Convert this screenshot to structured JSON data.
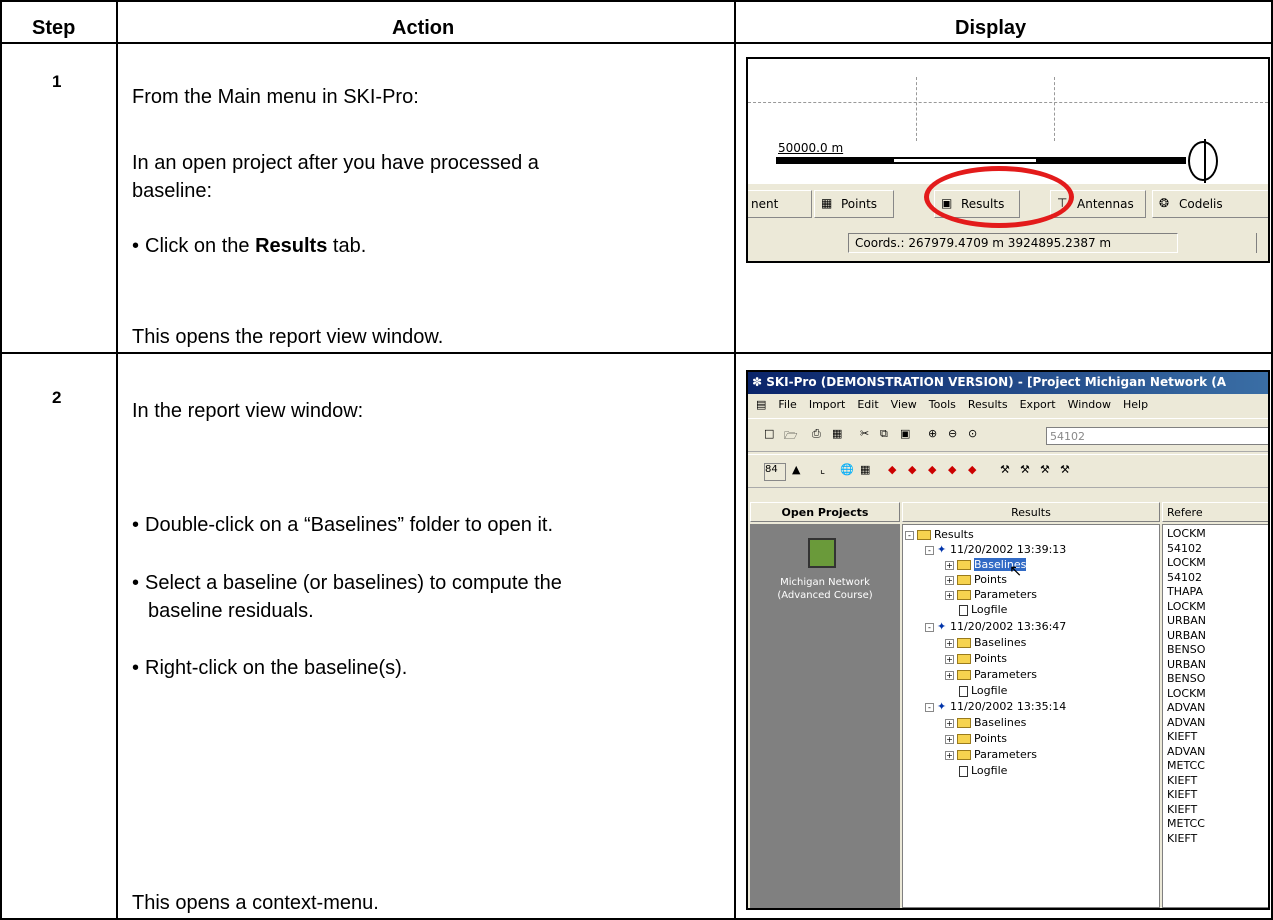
{
  "table": {
    "headers": {
      "step": "Step",
      "action": "Action",
      "display": "Display"
    },
    "rows": [
      {
        "step": "1",
        "lines": [
          "From the Main menu in SKI-Pro:",
          "In an open project after you have processed a",
          "baseline:",
          "Click on the ",
          "Results",
          " tab.",
          "This opens the report view window."
        ]
      },
      {
        "step": "2",
        "lines": [
          "In the report view window:",
          "Double-click on a “Baselines” folder to open it.",
          "Select a baseline (or baselines) to compute the",
          "baseline residuals.",
          "Right-click on the baseline(s).",
          "This opens a context-menu."
        ]
      }
    ]
  },
  "shot1": {
    "scale_label": "50000.0 m",
    "tabs": [
      "nent",
      "Points",
      "Results",
      "Antennas",
      "Codelis"
    ],
    "coords": "Coords.: 267979.4709 m  3924895.2387 m",
    "highlight_color": "#e31b1b"
  },
  "shot2": {
    "title": "SKI-Pro (DEMONSTRATION VERSION) - [Project Michigan Network (A",
    "menu": [
      "File",
      "Import",
      "Edit",
      "View",
      "Tools",
      "Results",
      "Export",
      "Window",
      "Help"
    ],
    "toolbar_input": "54102",
    "toolbar2_num": "84",
    "panels": {
      "left": "Open Projects",
      "mid": "Results",
      "right": "Refere"
    },
    "project_label": "Michigan Network (Advanced Course)",
    "tree": [
      {
        "label": "Results"
      },
      {
        "label": "11/20/2002 13:39:13"
      },
      {
        "label": "Baselines"
      },
      {
        "label": "Points"
      },
      {
        "label": "Parameters"
      },
      {
        "label": "Logfile"
      },
      {
        "label": "11/20/2002 13:36:47"
      },
      {
        "label": "Baselines"
      },
      {
        "label": "Points"
      },
      {
        "label": "Parameters"
      },
      {
        "label": "Logfile"
      },
      {
        "label": "11/20/2002 13:35:14"
      },
      {
        "label": "Baselines"
      },
      {
        "label": "Points"
      },
      {
        "label": "Parameters"
      },
      {
        "label": "Logfile"
      }
    ],
    "refs": [
      "LOCKM",
      "54102",
      "LOCKM",
      "54102",
      "THAPA",
      "LOCKM",
      "URBAN",
      "URBAN",
      "BENSO",
      "URBAN",
      "BENSO",
      "LOCKM",
      "ADVAN",
      "ADVAN",
      "KIEFT",
      "ADVAN",
      "METCC",
      "KIEFT",
      "KIEFT",
      "KIEFT",
      "METCC",
      "KIEFT"
    ],
    "title_color": "#0a246a"
  }
}
